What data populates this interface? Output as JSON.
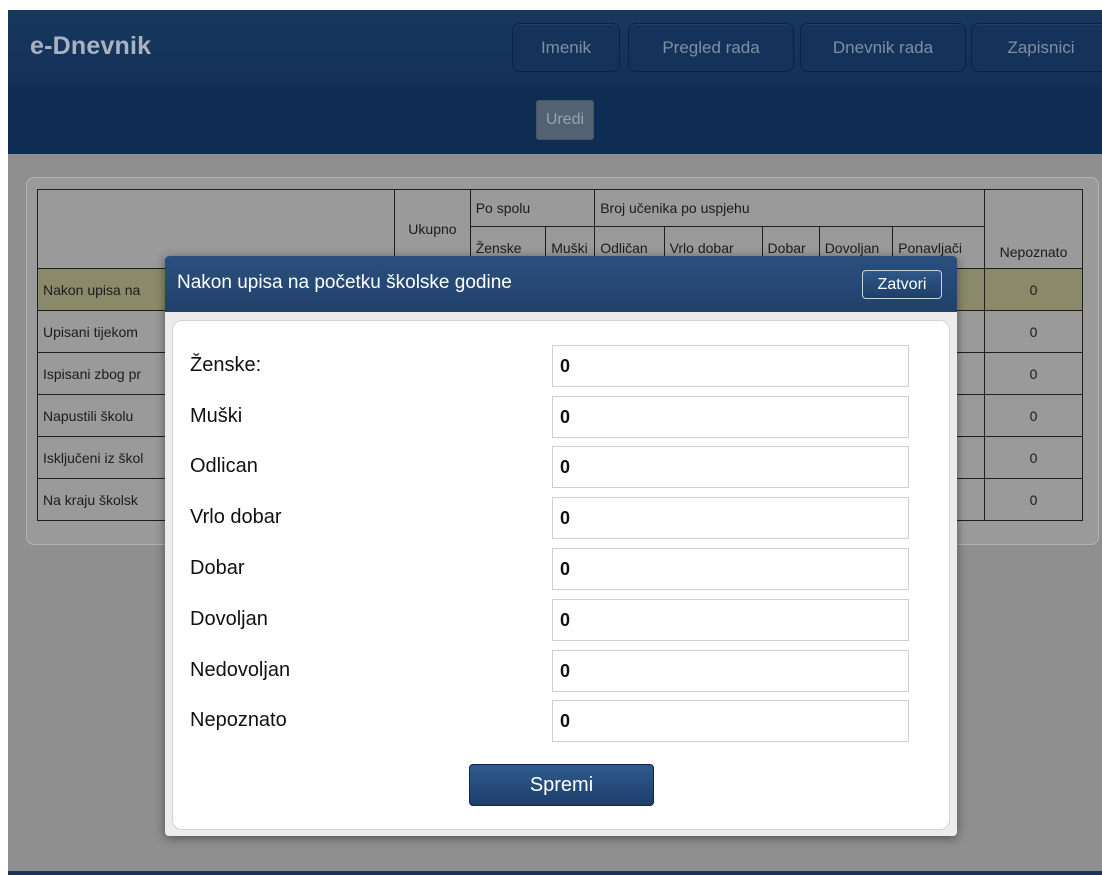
{
  "app": {
    "brand": "e-Dnevnik"
  },
  "nav": {
    "imenik": "Imenik",
    "pregled_rada": "Pregled rada",
    "dnevnik_rada": "Dnevnik rada",
    "zapisnici": "Zapisnici"
  },
  "subnav": {
    "uredi": "Uredi"
  },
  "table": {
    "headers": {
      "ukupno": "Ukupno",
      "po_spolu": "Po spolu",
      "broj_ucenika": "Broj učenika po uspjehu",
      "zenske": "Ženske",
      "muski": "Muški",
      "odlican": "Odličan",
      "vrlo_dobar": "Vrlo dobar",
      "dobar": "Dobar",
      "dovoljan": "Dovoljan",
      "ponavljaci": "Ponavljači",
      "nepoznato": "Nepoznato"
    },
    "rows": [
      {
        "label": "Nakon upisa na",
        "nepoznato": "0"
      },
      {
        "label": "Upisani tijekom",
        "nepoznato": "0"
      },
      {
        "label": "Ispisani zbog pr",
        "nepoznato": "0"
      },
      {
        "label": "Napustili školu",
        "nepoznato": "0"
      },
      {
        "label": "Isključeni iz škol",
        "nepoznato": "0"
      },
      {
        "label": "Na kraju školsk",
        "nepoznato": "0"
      }
    ]
  },
  "modal": {
    "title": "Nakon upisa na početku školske godine",
    "close_label": "Zatvori",
    "fields": [
      {
        "label": "Ženske:",
        "value": "0"
      },
      {
        "label": "Muški",
        "value": "0"
      },
      {
        "label": "Odlican",
        "value": "0"
      },
      {
        "label": "Vrlo dobar",
        "value": "0"
      },
      {
        "label": "Dobar",
        "value": "0"
      },
      {
        "label": "Dovoljan",
        "value": "0"
      },
      {
        "label": "Nedovoljan",
        "value": "0"
      },
      {
        "label": "Nepoznato",
        "value": "0"
      }
    ],
    "save_label": "Spremi"
  }
}
